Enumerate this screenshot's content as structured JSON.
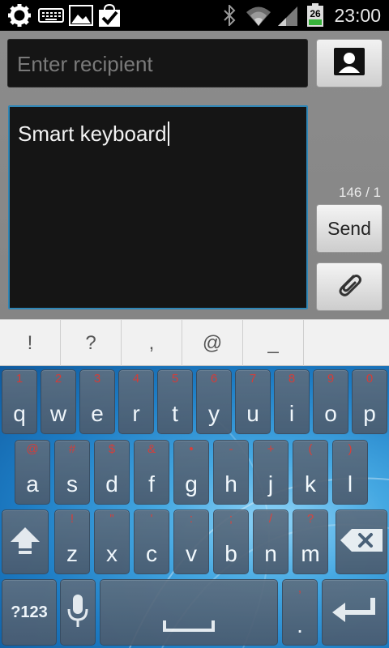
{
  "status_bar": {
    "time": "23:00",
    "battery_level": "26",
    "icons": [
      "settings-gear-icon",
      "keyboard-icon",
      "image-gallery-icon",
      "check-bag-icon",
      "bluetooth-icon",
      "wifi-icon",
      "signal-icon",
      "battery-icon"
    ]
  },
  "compose": {
    "recipient_placeholder": "Enter recipient",
    "message_text": "Smart keyboard",
    "counter": "146 / 1",
    "send_label": "Send"
  },
  "suggestions": [
    "!",
    "?",
    ",",
    "@",
    "_"
  ],
  "keyboard": {
    "row1": [
      {
        "pri": "q",
        "sec": "1"
      },
      {
        "pri": "w",
        "sec": "2"
      },
      {
        "pri": "e",
        "sec": "3"
      },
      {
        "pri": "r",
        "sec": "4"
      },
      {
        "pri": "t",
        "sec": "5"
      },
      {
        "pri": "y",
        "sec": "6"
      },
      {
        "pri": "u",
        "sec": "7"
      },
      {
        "pri": "i",
        "sec": "8"
      },
      {
        "pri": "o",
        "sec": "9"
      },
      {
        "pri": "p",
        "sec": "0"
      }
    ],
    "row2": [
      {
        "pri": "a",
        "sec": "@"
      },
      {
        "pri": "s",
        "sec": "#"
      },
      {
        "pri": "d",
        "sec": "$"
      },
      {
        "pri": "f",
        "sec": "&"
      },
      {
        "pri": "g",
        "sec": "•"
      },
      {
        "pri": "h",
        "sec": "-"
      },
      {
        "pri": "j",
        "sec": "+"
      },
      {
        "pri": "k",
        "sec": "("
      },
      {
        "pri": "l",
        "sec": ")"
      }
    ],
    "row3": [
      {
        "pri": "z",
        "sec": "!"
      },
      {
        "pri": "x",
        "sec": "\""
      },
      {
        "pri": "c",
        "sec": "'"
      },
      {
        "pri": "v",
        "sec": ":"
      },
      {
        "pri": "b",
        "sec": ";"
      },
      {
        "pri": "n",
        "sec": "/"
      },
      {
        "pri": "m",
        "sec": "?"
      }
    ],
    "symbols_label": "?123",
    "period_key": {
      "pri": ".",
      "sec": ","
    }
  },
  "colors": {
    "accent_border": "#2f86b6",
    "secondary_char": "#e2392f",
    "key_face": "#5c6f82"
  }
}
